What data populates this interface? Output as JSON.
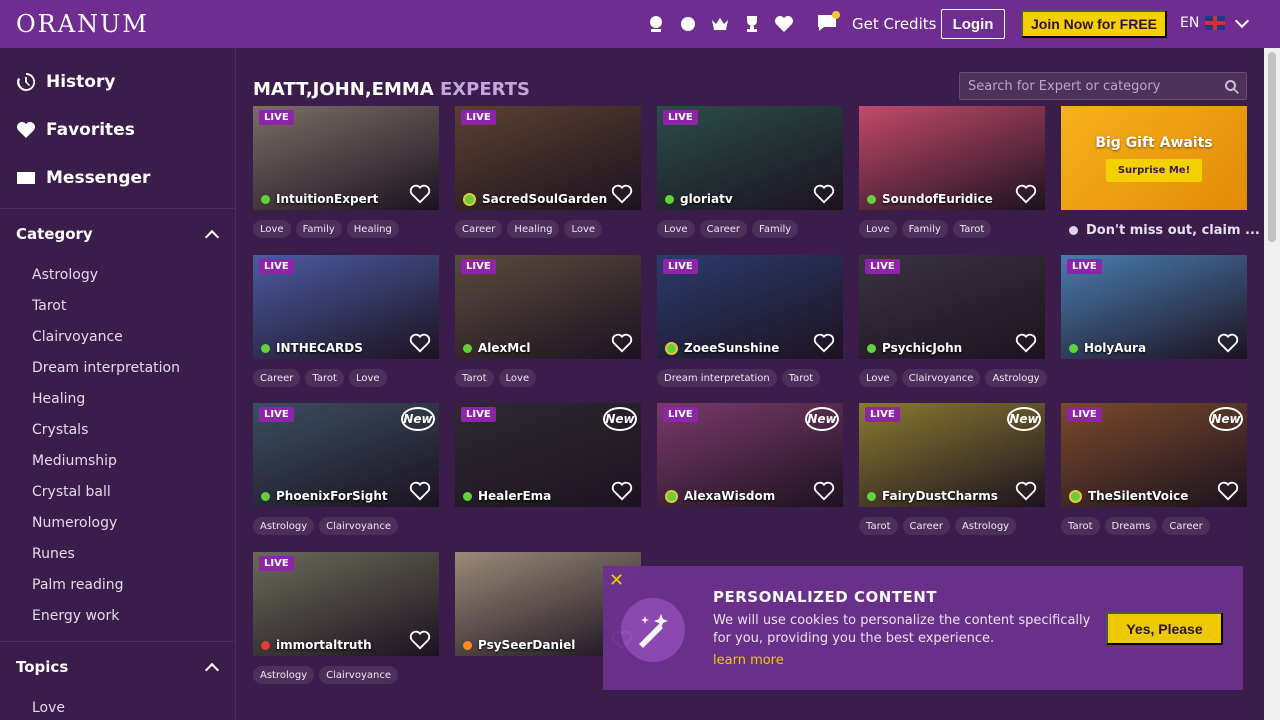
{
  "header": {
    "logo": "ORANUM",
    "credits_label": "Get Credits",
    "login_label": "Login",
    "join_label": "Join Now for FREE",
    "lang": "EN",
    "icons": [
      "psychic-icon",
      "horoscope-icon",
      "crown-icon",
      "trophy-icon",
      "heart-icon",
      "chat-icon"
    ]
  },
  "sidebar": {
    "nav": [
      {
        "label": "History",
        "icon": "history-icon"
      },
      {
        "label": "Favorites",
        "icon": "heart-icon"
      },
      {
        "label": "Messenger",
        "icon": "envelope-icon"
      }
    ],
    "category_title": "Category",
    "categories": [
      "Astrology",
      "Tarot",
      "Clairvoyance",
      "Dream interpretation",
      "Healing",
      "Crystals",
      "Mediumship",
      "Crystal ball",
      "Numerology",
      "Runes",
      "Palm reading",
      "Energy work"
    ],
    "topics_title": "Topics",
    "topics": [
      "Love"
    ]
  },
  "main": {
    "title_names": "MATT,JOHN,EMMA",
    "title_sub": "EXPERTS",
    "search_placeholder": "Search for Expert or category",
    "gift": {
      "title": "Big Gift Awaits",
      "button": "Surprise Me!",
      "caption": "Don't miss out, claim ..."
    },
    "live_label": "LIVE",
    "new_label": "New",
    "experts": [
      {
        "name": "IntuitionExpert",
        "status": "g",
        "live": true,
        "new": false,
        "tags": [
          "Love",
          "Family",
          "Healing"
        ],
        "bg": "#7a6e66"
      },
      {
        "name": "SacredSoulGarden",
        "status": "ring",
        "live": true,
        "new": false,
        "tags": [
          "Career",
          "Healing",
          "Love"
        ],
        "bg": "#5a4030"
      },
      {
        "name": "gloriatv",
        "status": "g",
        "live": true,
        "new": false,
        "tags": [
          "Love",
          "Career",
          "Family"
        ],
        "bg": "#2a4d48"
      },
      {
        "name": "SoundofEuridice",
        "status": "g",
        "live": false,
        "new": false,
        "tags": [
          "Love",
          "Family",
          "Tarot"
        ],
        "bg": "#c24a6a"
      },
      {
        "name": "INTHECARDS",
        "status": "g",
        "live": true,
        "new": false,
        "tags": [
          "Career",
          "Tarot",
          "Love"
        ],
        "bg": "#4b5aa0"
      },
      {
        "name": "AlexMcl",
        "status": "g",
        "live": true,
        "new": false,
        "tags": [
          "Tarot",
          "Love"
        ],
        "bg": "#5a4a3e"
      },
      {
        "name": "ZoeeSunshine",
        "status": "ring",
        "live": true,
        "new": false,
        "tags": [
          "Dream interpretation",
          "Tarot"
        ],
        "bg": "#2c3b6b"
      },
      {
        "name": "PsychicJohn",
        "status": "g",
        "live": true,
        "new": false,
        "tags": [
          "Love",
          "Clairvoyance",
          "Astrology"
        ],
        "bg": "#3a3340"
      },
      {
        "name": "HolyAura",
        "status": "g",
        "live": true,
        "new": false,
        "tags": [],
        "bg": "#4a7cae"
      },
      {
        "name": "PhoenixForSight",
        "status": "g",
        "live": true,
        "new": true,
        "tags": [
          "Astrology",
          "Clairvoyance"
        ],
        "bg": "#3a4e60"
      },
      {
        "name": "HealerEma",
        "status": "g",
        "live": true,
        "new": true,
        "tags": [],
        "bg": "#2e2a30"
      },
      {
        "name": "AlexaWisdom",
        "status": "ring",
        "live": true,
        "new": true,
        "tags": [],
        "bg": "#7a3a6a"
      },
      {
        "name": "FairyDustCharms",
        "status": "g",
        "live": true,
        "new": true,
        "tags": [
          "Tarot",
          "Career",
          "Astrology"
        ],
        "bg": "#8a7a30"
      },
      {
        "name": "TheSilentVoice",
        "status": "ring",
        "live": true,
        "new": true,
        "tags": [
          "Tarot",
          "Dreams",
          "Career"
        ],
        "bg": "#7a4a2a"
      },
      {
        "name": "immortaltruth",
        "status": "r",
        "live": true,
        "new": false,
        "tags": [
          "Astrology",
          "Clairvoyance"
        ],
        "bg": "#6a6a58"
      },
      {
        "name": "PsySeerDaniel",
        "status": "o",
        "live": false,
        "new": false,
        "tags": [],
        "bg": "#9a8a78"
      }
    ]
  },
  "cookie": {
    "title": "PERSONALIZED CONTENT",
    "text": "We will use cookies to personalize the content specifically for you, providing you the best experience.",
    "link": "learn more",
    "button": "Yes, Please"
  }
}
